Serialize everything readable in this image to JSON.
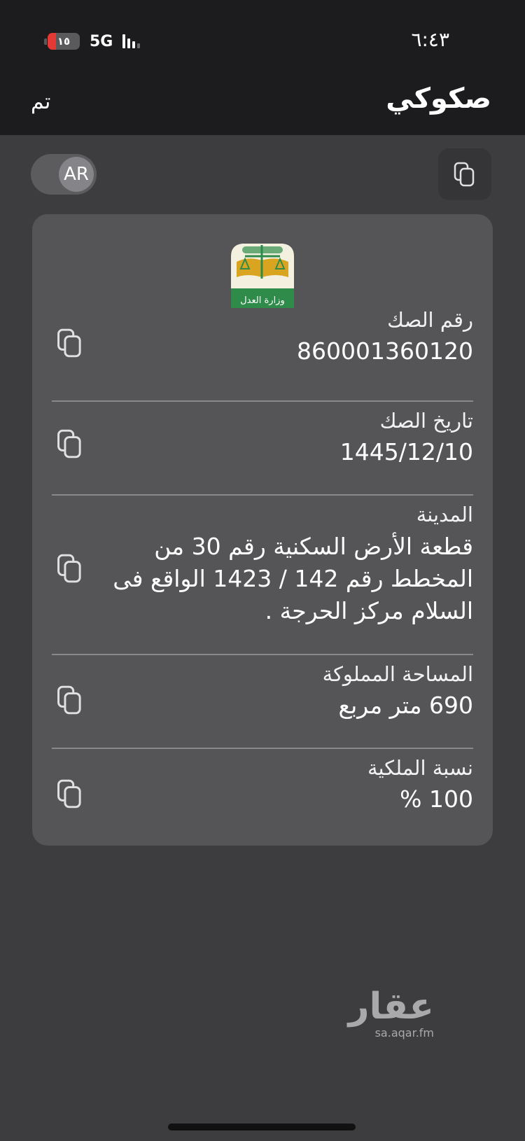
{
  "status_bar": {
    "time": "٦:٤٣",
    "network": "5G",
    "battery_level": "١٥",
    "battery_color": "#e53935"
  },
  "nav": {
    "title": "صكوكي",
    "done_label": "تم"
  },
  "language_toggle": {
    "label": "AR"
  },
  "deed": {
    "logo_text": "وزارة العدل",
    "fields": [
      {
        "label": "رقم الصك",
        "value": "860001360120"
      },
      {
        "label": "تاريخ الصك",
        "value": "1445/12/10"
      },
      {
        "label": "المدينة",
        "value": "قطعة الأرض السكنية رقم 30 من المخطط رقم 142 / 1423 الواقع فى السلام مركز الحرجة ."
      },
      {
        "label": "المساحة المملوكة",
        "value": "690 متر مربع"
      },
      {
        "label": "نسبة الملكية",
        "value": "100 %"
      }
    ]
  },
  "watermark": {
    "brand": "عقار",
    "url": "sa.aqar.fm"
  },
  "icons": {
    "copy": "copy-icon",
    "logo": "ministry-of-justice-logo"
  }
}
